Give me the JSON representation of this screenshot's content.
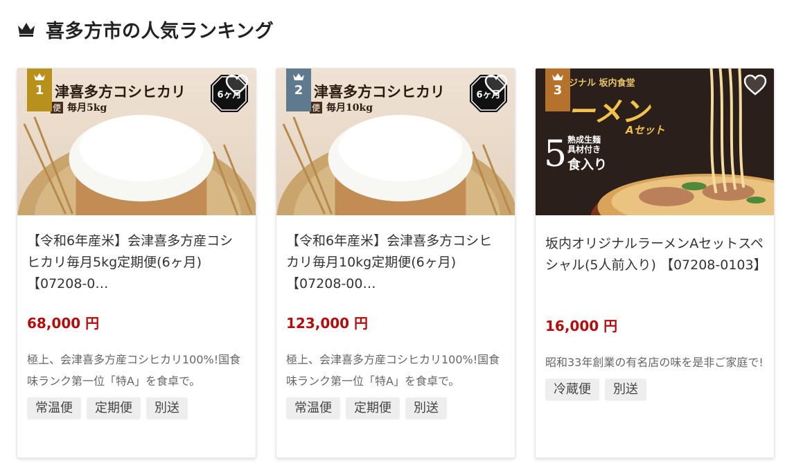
{
  "header": {
    "title": "喜多方市の人気ランキング",
    "icon": "crown-icon"
  },
  "colors": {
    "price": "#b20d0d",
    "rank1": "#b8901c",
    "rank2": "#5f7a8e",
    "rank3": "#b5722d",
    "tag_bg": "#eeeeee"
  },
  "cards": [
    {
      "rank": "1",
      "banner_title": "津喜多方コシヒカリ",
      "banner_sub": "毎月5kg",
      "banner_tag": "便",
      "badge_text": "6ヶ月",
      "title": "【令和6年産米】会津喜多方産コシヒカリ毎月5kg定期便(6ヶ月) 【07208-0…",
      "price": "68,000 円",
      "description": "極上、会津喜多方産コシヒカリ100%!国食味ランク第一位「特A」を食卓で。",
      "tags": [
        "常温便",
        "定期便",
        "別送"
      ]
    },
    {
      "rank": "2",
      "banner_title": "津喜多方コシヒカリ",
      "banner_sub": "毎月10kg",
      "banner_tag": "便",
      "badge_text": "6ヶ月",
      "title": "【令和6年産米】会津喜多方コシヒカリ毎月10kg定期便(6ヶ月) 【07208-00…",
      "price": "123,000 円",
      "description": "極上、会津喜多方産コシヒカリ100%!国食味ランク第一位「特A」を食卓で。",
      "tags": [
        "常温便",
        "定期便",
        "別送"
      ]
    },
    {
      "rank": "3",
      "banner_top": "ジナル 坂内食堂",
      "banner_title": "ーメン",
      "banner_set": "Aセット",
      "banner_num": "5",
      "banner_line1": "熟成生麺",
      "banner_line2": "具材付き",
      "banner_line3": "食入り",
      "title": "坂内オリジナルラーメンAセットスペシャル(5人前入り) 【07208-0103】",
      "price": "16,000 円",
      "description": "昭和33年創業の有名店の味を是非ご家庭で!",
      "tags": [
        "冷蔵便",
        "別送"
      ]
    }
  ]
}
